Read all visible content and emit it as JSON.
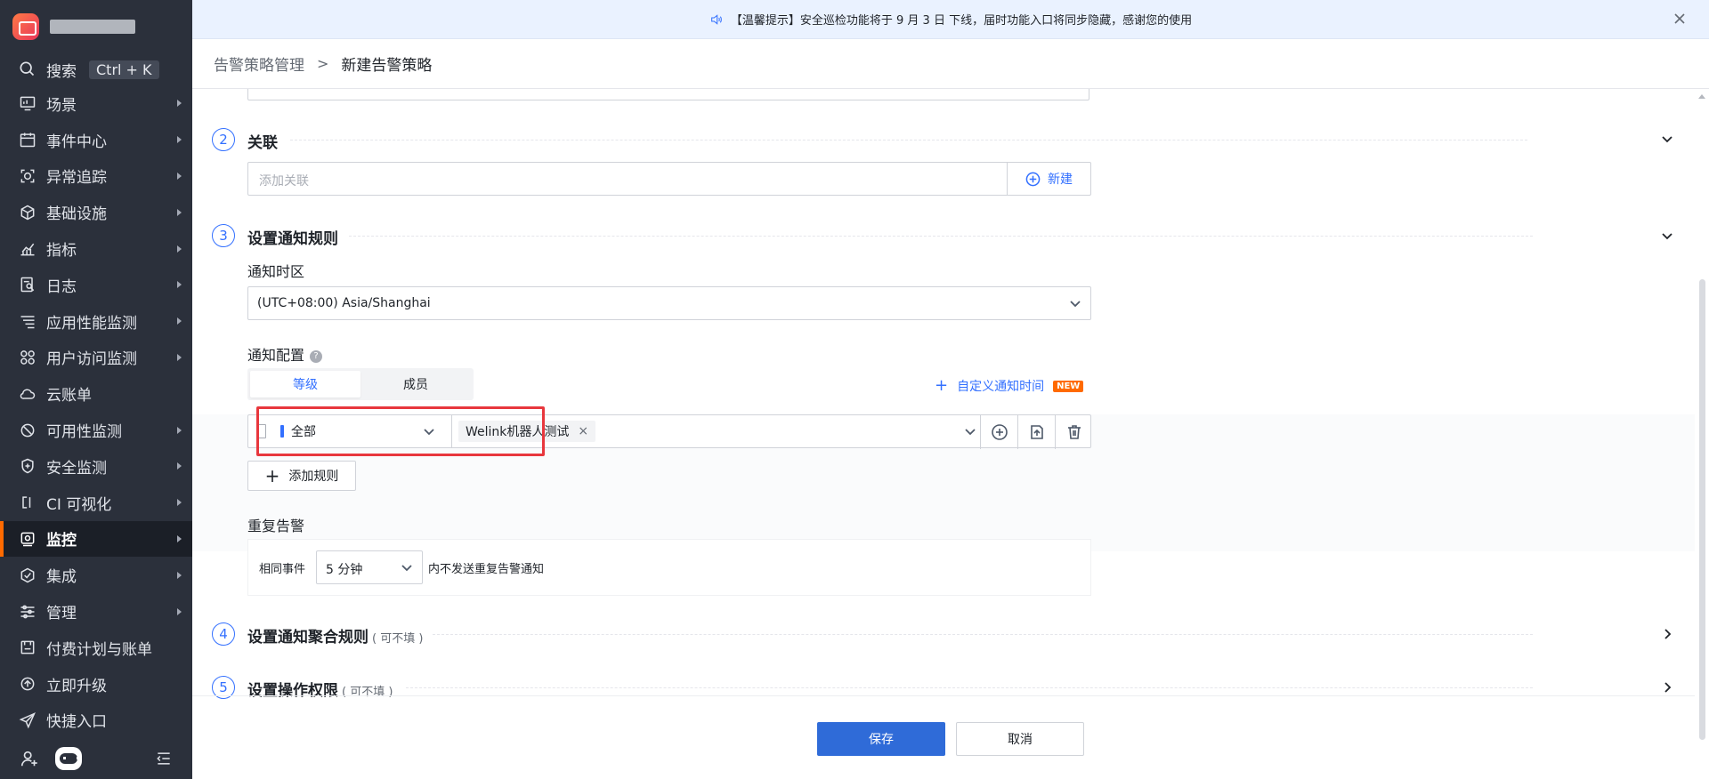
{
  "sidebar": {
    "search_label": "搜索",
    "search_shortcut": "Ctrl + K",
    "items": [
      {
        "label": "场景",
        "icon": "monitor-icon"
      },
      {
        "label": "事件中心",
        "icon": "calendar-icon"
      },
      {
        "label": "异常追踪",
        "icon": "target-icon"
      },
      {
        "label": "基础设施",
        "icon": "cube-icon"
      },
      {
        "label": "指标",
        "icon": "chart-icon"
      },
      {
        "label": "日志",
        "icon": "log-icon"
      },
      {
        "label": "应用性能监测",
        "icon": "list-icon"
      },
      {
        "label": "用户访问监测",
        "icon": "grid-icon"
      },
      {
        "label": "云账单",
        "icon": "cloud-icon"
      },
      {
        "label": "可用性监测",
        "icon": "ban-icon"
      },
      {
        "label": "安全监测",
        "icon": "shield-icon"
      },
      {
        "label": "CI 可视化",
        "icon": "ci-icon"
      },
      {
        "label": "监控",
        "icon": "monitor-camera-icon"
      },
      {
        "label": "集成",
        "icon": "hexagon-icon"
      },
      {
        "label": "管理",
        "icon": "sliders-icon"
      },
      {
        "label": "付费计划与账单",
        "icon": "bill-icon"
      },
      {
        "label": "立即升级",
        "icon": "upgrade-icon"
      },
      {
        "label": "快捷入口",
        "icon": "send-icon"
      }
    ]
  },
  "notice": {
    "text": "【温馨提示】安全巡检功能将于 9 月 3 日 下线，届时功能入口将同步隐藏，感谢您的使用"
  },
  "breadcrumb": {
    "parent": "告警策略管理",
    "separator": ">",
    "current": "新建告警策略"
  },
  "step2": {
    "num": "2",
    "title": "关联",
    "input_placeholder": "添加关联",
    "new_label": "新建"
  },
  "step3": {
    "num": "3",
    "title": "设置通知规则",
    "timezone_label": "通知时区",
    "timezone_value": "(UTC+08:00) Asia/Shanghai",
    "config_label": "通知配置",
    "tabs": [
      "等级",
      "成员"
    ],
    "custom_time_label": "自定义通知时间",
    "new_badge": "NEW",
    "level_value": "全部",
    "target_value": "Welink机器人测试",
    "add_rule_label": "添加规则",
    "repeat_label": "重复告警",
    "same_event_label": "相同事件",
    "interval_value": "5 分钟",
    "repeat_suffix": "内不发送重复告警通知"
  },
  "step4": {
    "num": "4",
    "title": "设置通知聚合规则",
    "optional": "( 可不填 )"
  },
  "step5": {
    "num": "5",
    "title": "设置操作权限",
    "optional": "( 可不填 )"
  },
  "actions": {
    "save": "保存",
    "cancel": "取消"
  },
  "colors": {
    "sidebar_bg": "#2b303b",
    "accent": "#3370ff",
    "primary_button": "#2f6bd8",
    "highlight": "#e8373d",
    "active_marker": "#ff6a00"
  }
}
